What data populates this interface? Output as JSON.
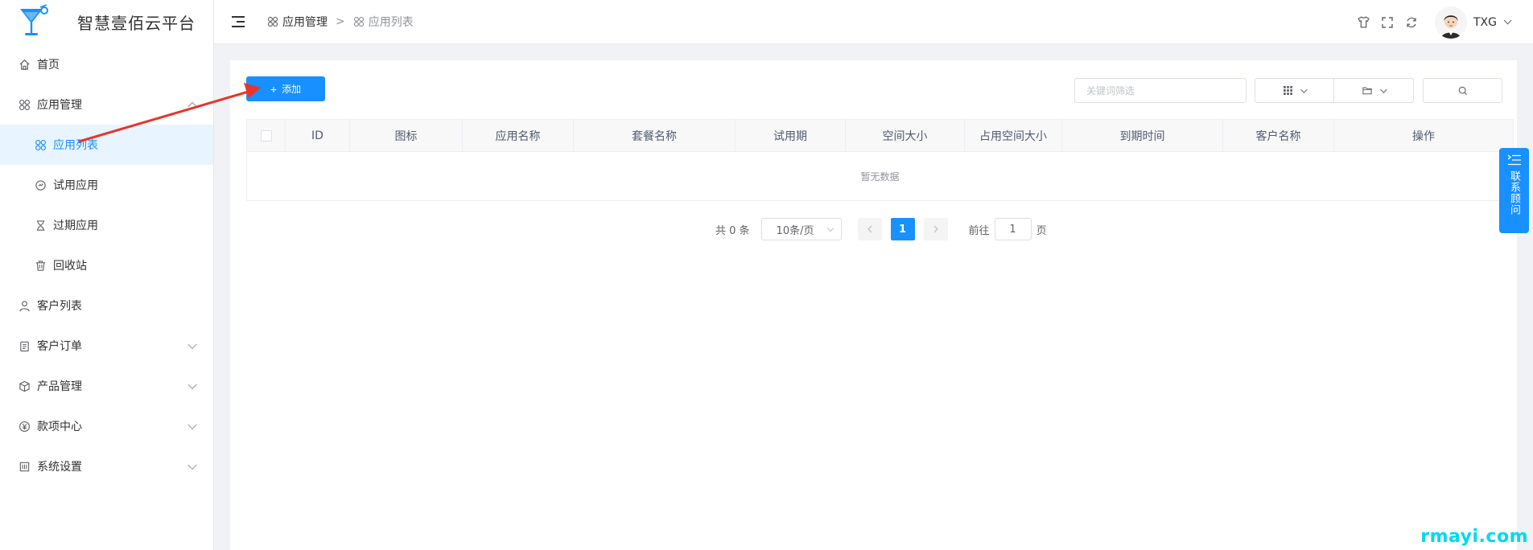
{
  "app": {
    "title": "智慧壹佰云平台",
    "accent_color": "#1890ff"
  },
  "sidebar": {
    "items": [
      {
        "label": "首页",
        "icon": "home-icon"
      },
      {
        "label": "应用管理",
        "icon": "apps-icon",
        "expanded": true
      },
      {
        "label": "应用列表",
        "icon": "apps-icon",
        "active": true
      },
      {
        "label": "试用应用",
        "icon": "trial-icon"
      },
      {
        "label": "过期应用",
        "icon": "hourglass-icon"
      },
      {
        "label": "回收站",
        "icon": "trash-icon"
      },
      {
        "label": "客户列表",
        "icon": "user-icon"
      },
      {
        "label": "客户订单",
        "icon": "clipboard-icon",
        "expandable": true
      },
      {
        "label": "产品管理",
        "icon": "box-icon",
        "expandable": true
      },
      {
        "label": "款项中心",
        "icon": "yen-icon",
        "expandable": true
      },
      {
        "label": "系统设置",
        "icon": "settings-icon",
        "expandable": true
      }
    ]
  },
  "header": {
    "breadcrumb": {
      "first": "应用管理",
      "separator": ">",
      "last": "应用列表"
    },
    "user_name": "TXG"
  },
  "toolbar": {
    "add_label": "添加",
    "search_placeholder": "关键词筛选"
  },
  "table": {
    "columns": [
      "ID",
      "图标",
      "应用名称",
      "套餐名称",
      "试用期",
      "空间大小",
      "占用空间大小",
      "到期时间",
      "客户名称",
      "操作"
    ],
    "empty_text": "暂无数据"
  },
  "pagination": {
    "total_text": "共 0 条",
    "page_size": "10条/页",
    "current_page": "1",
    "goto_label": "前往",
    "goto_value": "1",
    "page_suffix": "页"
  },
  "contact": {
    "label": "联系顾问"
  },
  "watermark": "rmayi.com"
}
